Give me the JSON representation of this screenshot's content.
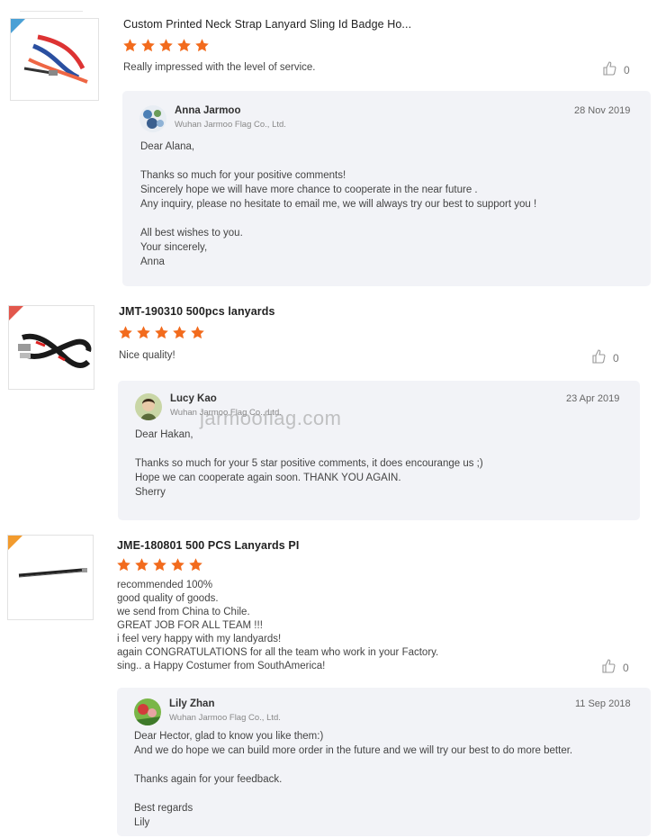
{
  "reviews": [
    {
      "title": "Custom Printed Neck Strap Lanyard Sling Id Badge Ho...",
      "rating": 5,
      "comment": "Really impressed with the level of service.",
      "likes": "0",
      "reply": {
        "name": "Anna Jarmoo",
        "company": "Wuhan Jarmoo Flag Co., Ltd.",
        "date": "28 Nov 2019",
        "text": "Dear Alana,\n\nThanks so much for your positive comments!\nSincerely hope we will have more chance to cooperate in the near future .\nAny inquiry, please no hesitate to email me, we will always try our best to support you !\n\nAll best wishes to you.\nYour sincerely,\nAnna"
      }
    },
    {
      "title": "JMT-190310 500pcs lanyards",
      "rating": 5,
      "comment": "Nice quality!",
      "likes": "0",
      "reply": {
        "name": "Lucy Kao",
        "company": "Wuhan Jarmoo Flag Co., Ltd.",
        "date": "23 Apr 2019",
        "text": "Dear Hakan,\n\nThanks so much for your 5 star positive comments, it  does encourange us ;)\nHope we can cooperate again soon.  THANK YOU AGAIN.\nSherry"
      }
    },
    {
      "title": "JME-180801 500 PCS Lanyards PI",
      "rating": 5,
      "comment": "recommended 100%\ngood quality of goods.\nwe send from China to Chile.\nGREAT JOB FOR ALL TEAM !!!\ni feel very happy with my landyards!\nagain CONGRATULATIONS for all the team who work in your Factory.\nsing.. a Happy Costumer from SouthAmerica!",
      "likes": "0",
      "reply": {
        "name": "Lily Zhan",
        "company": "Wuhan Jarmoo Flag Co., Ltd.",
        "date": "11 Sep 2018",
        "text": "Dear Hector, glad to know you like them:)\nAnd we do hope we can build more order in the future and we will try our best to do more better.\n\nThanks again for your feedback.\n\nBest regards\nLily"
      }
    }
  ],
  "watermark": "jarmooflag.com",
  "colors": {
    "star": "#f26b1d",
    "reply_bg": "#f2f3f7"
  },
  "icons": {
    "like": "thumbs-up-icon",
    "star": "star-icon"
  }
}
